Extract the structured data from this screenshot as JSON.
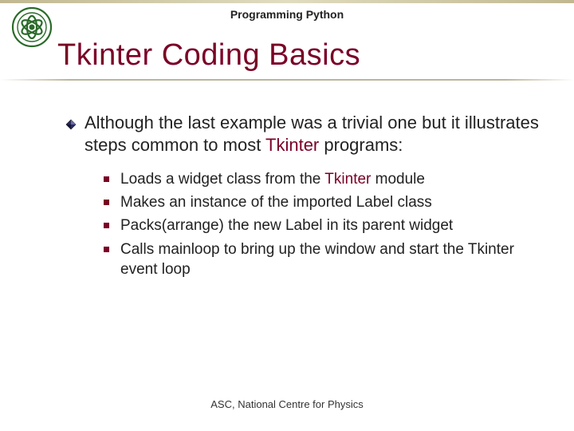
{
  "header": {
    "subtitle": "Programming Python",
    "title": "Tkinter Coding Basics"
  },
  "bullet1": {
    "part1": "Although the last example was a trivial one but it illustrates steps common to most ",
    "tk": "Tkinter",
    "part2": " programs:"
  },
  "sub": [
    {
      "pre": "Loads a widget class from the ",
      "tk": "Tkinter",
      "post": " module"
    },
    {
      "text": "Makes an instance of the imported Label class"
    },
    {
      "text": "Packs(arrange) the new Label in its parent widget"
    },
    {
      "text": "Calls mainloop to bring up the window and start the Tkinter event loop"
    }
  ],
  "footer": "ASC, National Centre for Physics"
}
